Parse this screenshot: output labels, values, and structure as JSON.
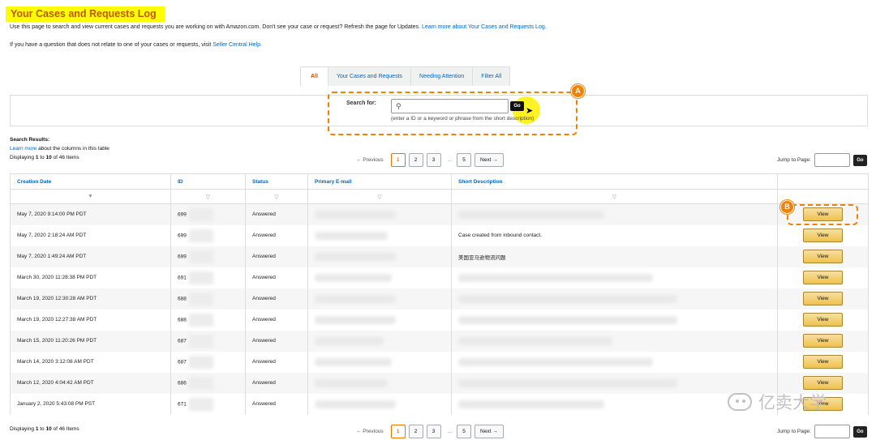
{
  "title": "Your Cases and Requests Log",
  "intro": {
    "text": "Use this page to search and view current cases and requests you are working on with Amazon.com. Don't see your case or request? Refresh the page for Updates.",
    "link": "Learn more about Your Cases and Requests Log.",
    "line2": "If you have a question that does not relate to one of your cases or requests, visit",
    "line2_link": "Seller Central Help."
  },
  "tabs": [
    {
      "label": "All",
      "active": true
    },
    {
      "label": "Your Cases and Requests",
      "active": false
    },
    {
      "label": "Needing Attention",
      "active": false
    },
    {
      "label": "Filter All",
      "active": false
    }
  ],
  "search": {
    "label": "Search for:",
    "value": "",
    "placeholder": "",
    "go_label": "Go",
    "hint": "(enter a ID or a keyword or phrase from the short description)"
  },
  "annotations": {
    "a": "A",
    "b": "B"
  },
  "results": {
    "heading": "Search Results:",
    "learn_link": "Learn more",
    "learn_text": "about the columns in this table",
    "displaying_prefix": "Displaying",
    "range_start": "1",
    "to": "to",
    "range_end": "10",
    "of_text": "of 46 Items"
  },
  "pager": {
    "previous": "← Previous",
    "pages": [
      "1",
      "2",
      "3"
    ],
    "ellipsis": "...",
    "last": "5",
    "next": "Next →",
    "current": "1"
  },
  "jump": {
    "label": "Jump to Page:",
    "go_label": "Go"
  },
  "table": {
    "columns": [
      "Creation Date",
      "ID",
      "Status",
      "Primary E-mail",
      "Short Description",
      ""
    ],
    "rows": [
      {
        "date": "May 7, 2020 9:14:00 PM PDT",
        "id": "699",
        "status": "Answered",
        "desc": "",
        "action": "View"
      },
      {
        "date": "May 7, 2020 2:18:24 AM PDT",
        "id": "699",
        "status": "Answered",
        "desc": "Case created from inbound contact.",
        "action": "View"
      },
      {
        "date": "May 7, 2020 1:49:24 AM PDT",
        "id": "699",
        "status": "Answered",
        "desc": "美国亚马逊物流问题",
        "action": "View"
      },
      {
        "date": "March 30, 2020 11:28:38 PM PDT",
        "id": "691",
        "status": "Answered",
        "desc": "",
        "action": "View"
      },
      {
        "date": "March 19, 2020 12:30:28 AM PDT",
        "id": "688",
        "status": "Answered",
        "desc": "",
        "action": "View"
      },
      {
        "date": "March 19, 2020 12:27:38 AM PDT",
        "id": "688",
        "status": "Answered",
        "desc": "",
        "action": "View"
      },
      {
        "date": "March 15, 2020 11:20:26 PM PDT",
        "id": "687",
        "status": "Answered",
        "desc": "",
        "action": "View"
      },
      {
        "date": "March 14, 2020 3:12:08 AM PDT",
        "id": "687",
        "status": "Answered",
        "desc": "",
        "action": "View"
      },
      {
        "date": "March 12, 2020 4:04:42 AM PDT",
        "id": "686",
        "status": "Answered",
        "desc": "",
        "action": "View"
      },
      {
        "date": "January 2, 2020 5:43:08 PM PST",
        "id": "671",
        "status": "Answered",
        "desc": "",
        "action": "View"
      }
    ]
  },
  "watermark": "亿卖大学",
  "colors": {
    "title_bg": "#ffff00",
    "title_text": "#c45500",
    "link": "#0066c0",
    "annotation": "#f08200",
    "view_button": "#f0c14b"
  }
}
